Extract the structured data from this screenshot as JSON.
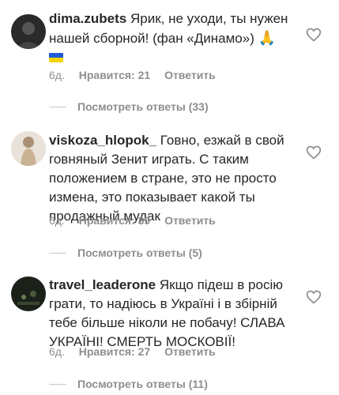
{
  "comments": [
    {
      "username": "dima.zubets",
      "text": "Ярик, не уходи, ты нужен нашей сборной! (фан «Динамо»)",
      "emoji": "🙏",
      "flag": "ukraine-flag",
      "time": "6д.",
      "likes": "Нравится: 21",
      "reply": "Ответить",
      "view_replies": "Посмотреть ответы (33)"
    },
    {
      "username": "viskoza_hlopok_",
      "text": "Говно, езжай в свой говняный Зенит играть. С таким положением в стране, это не просто измена, это показывает какой ты продажный мудак",
      "time": "6д.",
      "likes": "Нравится: 39",
      "reply": "Ответить",
      "view_replies": "Посмотреть ответы (5)"
    },
    {
      "username": "travel_leaderone",
      "text": "Якщо підеш в росію грати, то надіюсь в Україні і в збірній тебе більше ніколи не побачу! СЛАВА УКРАЇНІ! СМЕРТЬ МОСКОВІЇ!",
      "time": "6д.",
      "likes": "Нравится: 27",
      "reply": "Ответить",
      "view_replies": "Посмотреть ответы (11)"
    }
  ],
  "colors": {
    "text": "#262626",
    "muted": "#8e8e8e",
    "flag_blue": "#1f5bd8",
    "flag_yellow": "#f6d40a"
  }
}
